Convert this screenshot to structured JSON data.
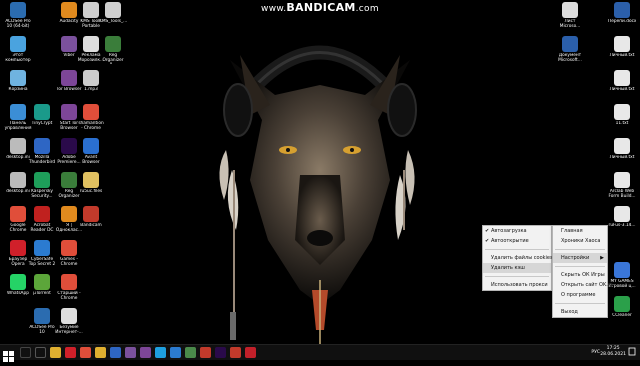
{
  "watermark": {
    "prefix": "www.",
    "brand": "BANDICAM",
    "suffix": ".com"
  },
  "desktop_icons": [
    {
      "label": "ACDSee Pro 10 (64-bit)",
      "color": "#2b6cb0",
      "icon": "acdsee-icon"
    },
    {
      "label": "Audacity",
      "color": "#e08a1e",
      "icon": "audacity-icon"
    },
    {
      "label": "KMS Tools Portable",
      "color": "#cfcfcf",
      "icon": "folder-icon"
    },
    {
      "label": "KMS_Tools_...",
      "color": "#cfcfcf",
      "icon": "folder-icon"
    },
    {
      "label": "Этот компьютер",
      "color": "#4aa3df",
      "icon": "computer-icon"
    },
    {
      "label": "Viber",
      "color": "#7b519d",
      "icon": "viber-icon"
    },
    {
      "label": "Реклама Морозилк...",
      "color": "#dddddd",
      "icon": "document-icon"
    },
    {
      "label": "Reg Organizer 8...",
      "color": "#3a7d3a",
      "icon": "reg-organizer-icon"
    },
    {
      "label": "Корзина",
      "color": "#6fb3e0",
      "icon": "recycle-bin-icon"
    },
    {
      "label": "Tor Browser",
      "color": "#7d4698",
      "icon": "tor-icon"
    },
    {
      "label": "1.mp3",
      "color": "#cccccc",
      "icon": "audio-file-icon"
    },
    {
      "label": "Панель управления",
      "color": "#3b8ed6",
      "icon": "control-panel-icon"
    },
    {
      "label": "TinyCrypt",
      "color": "#1a9a8a",
      "icon": "tinycrypt-icon"
    },
    {
      "label": "Start Tor Browser",
      "color": "#7d4698",
      "icon": "tor-icon"
    },
    {
      "label": "shamantion - Chrome",
      "color": "#e04e3a",
      "icon": "chrome-icon"
    },
    {
      "label": "desktop.ini",
      "color": "#bbbbbb",
      "icon": "ini-file-icon"
    },
    {
      "label": "Mozilla Thunderbird",
      "color": "#2e66c4",
      "icon": "thunderbird-icon"
    },
    {
      "label": "Adobe Premiere...",
      "color": "#2a0a4a",
      "icon": "premiere-icon"
    },
    {
      "label": "Avant Browser",
      "color": "#2a6fd0",
      "icon": "avant-icon"
    },
    {
      "label": "desktop.ini",
      "color": "#bbbbbb",
      "icon": "ini-file-icon"
    },
    {
      "label": "Kaspersky Security...",
      "color": "#1e9e5a",
      "icon": "kaspersky-icon"
    },
    {
      "label": "Reg Organizer",
      "color": "#3a7d3a",
      "icon": "reg-organizer-icon"
    },
    {
      "label": "ru5uc.files",
      "color": "#e0c060",
      "icon": "folder-icon"
    },
    {
      "label": "Google Chrome",
      "color": "#e04e3a",
      "icon": "chrome-icon"
    },
    {
      "label": "Acrobat Reader DC",
      "color": "#c0211f",
      "icon": "acrobat-icon"
    },
    {
      "label": "Я | Одноклас...",
      "color": "#e08a1e",
      "icon": "chrome-icon"
    },
    {
      "label": "Bandicam",
      "color": "#c23a2b",
      "icon": "bandicam-icon"
    },
    {
      "label": "Браузер Opera",
      "color": "#d0202a",
      "icon": "opera-icon"
    },
    {
      "label": "CyberSafe Top Secret 2",
      "color": "#2b7bd0",
      "icon": "cybersafe-icon"
    },
    {
      "label": "Games - Chrome",
      "color": "#e04e3a",
      "icon": "chrome-icon"
    },
    {
      "label": "WhatsApp",
      "color": "#25d366",
      "icon": "whatsapp-icon"
    },
    {
      "label": "µTorrent",
      "color": "#5ca63a",
      "icon": "utorrent-icon"
    },
    {
      "label": "Старший - Chrome",
      "color": "#e04e3a",
      "icon": "chrome-icon"
    },
    {
      "label": "ACDSee Pro 10",
      "color": "#2b6cb0",
      "icon": "acdsee-icon"
    },
    {
      "label": "Безумие Интернет-...",
      "color": "#dddddd",
      "icon": "document-icon"
    },
    {
      "label": "Лист Microso...",
      "color": "#dddddd",
      "icon": "document-icon"
    },
    {
      "label": "Перепи.docx",
      "color": "#2b5faa",
      "icon": "word-icon"
    },
    {
      "label": "Документ Microsoft...",
      "color": "#2b5faa",
      "icon": "word-icon"
    },
    {
      "label": "Личный.txt",
      "color": "#e8e8e8",
      "icon": "text-file-icon"
    },
    {
      "label": "Личный.txt",
      "color": "#e8e8e8",
      "icon": "text-file-icon"
    },
    {
      "label": "11.txt",
      "color": "#e8e8e8",
      "icon": "text-file-icon"
    },
    {
      "label": "Личный.txt",
      "color": "#e8e8e8",
      "icon": "text-file-icon"
    },
    {
      "label": "Arclab Web Form Build...",
      "color": "#e8e8e8",
      "icon": "arclab-icon"
    },
    {
      "label": "ruFus-3.14...",
      "color": "#e8e8e8",
      "icon": "usb-icon"
    },
    {
      "label": "MY GAMES Игровой ц...",
      "color": "#3a76d8",
      "icon": "mygames-icon"
    },
    {
      "label": "CCleaner",
      "color": "#2ba04a",
      "icon": "ccleaner-icon"
    }
  ],
  "menu_left": {
    "items": [
      {
        "label": "Автозагрузка",
        "checked": "✔"
      },
      {
        "label": "Автооткрытие",
        "checked": "✔"
      },
      {
        "label": "Удалить файлы cookies",
        "checked": ""
      },
      {
        "label": "Удалить кэш",
        "checked": ""
      },
      {
        "label": "Использовать прокси",
        "checked": ""
      }
    ]
  },
  "menu_right": {
    "items": [
      {
        "label": "Главная"
      },
      {
        "label": "Хроники Хаоса"
      },
      {
        "label": "Настройки",
        "arrow": "▶"
      },
      {
        "label": "Скрыть ОК Игры"
      },
      {
        "label": "Открыть сайт OK.ru"
      },
      {
        "label": "О программе"
      },
      {
        "label": "Выход"
      }
    ]
  },
  "taskbar": {
    "start_icon": "windows-start-icon",
    "pinned": [
      {
        "name": "search-icon",
        "color": "#444444"
      },
      {
        "name": "task-view-icon",
        "color": "#555555"
      },
      {
        "name": "explorer-icon",
        "color": "#e0b030"
      },
      {
        "name": "opera-icon",
        "color": "#d0202a"
      },
      {
        "name": "chrome-icon",
        "color": "#e04e3a"
      },
      {
        "name": "folder-icon",
        "color": "#e0b030"
      },
      {
        "name": "mail-icon",
        "color": "#2e66c4"
      },
      {
        "name": "viber-icon",
        "color": "#7b519d"
      },
      {
        "name": "tor-icon",
        "color": "#7d4698"
      },
      {
        "name": "skype-icon",
        "color": "#1ea0e0"
      },
      {
        "name": "app-icon",
        "color": "#2b7bd0"
      },
      {
        "name": "app-icon",
        "color": "#4a8a4a"
      },
      {
        "name": "app-icon",
        "color": "#c23a2b"
      },
      {
        "name": "app-icon",
        "color": "#2a0a4a"
      },
      {
        "name": "bandicam-icon",
        "color": "#c23a2b"
      },
      {
        "name": "record-icon",
        "color": "#c2202a"
      }
    ],
    "language": "РУС",
    "time": "17:25",
    "date": "28.06.2021"
  }
}
